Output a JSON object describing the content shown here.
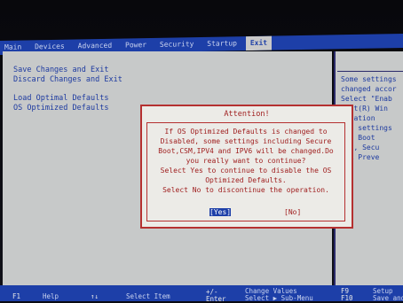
{
  "menu": {
    "tabs": [
      "Main",
      "Devices",
      "Advanced",
      "Power",
      "Security",
      "Startup",
      "Exit"
    ],
    "active_tab": "Exit"
  },
  "main": {
    "items": [
      "Save Changes and Exit",
      "Discard Changes and Exit",
      "Load Optimal Defaults",
      "OS Optimized Defaults"
    ]
  },
  "help": {
    "lines": [
      "Some settings",
      "changed accor",
      "Select \"Enab",
      "soft(R) Win",
      "fication",
      "ert settings",
      "rt, Boot",
      "ity, Secu",
      "ack Preve"
    ]
  },
  "dialog": {
    "title": "Attention!",
    "message": [
      "If OS Optimized Defaults is changed to",
      "Disabled, some settings including Secure",
      "Boot,CSM,IPV4 and IPV6 will be changed.Do",
      "you really want to continue?",
      "Select Yes to continue to disable the OS",
      "Optimized Defaults.",
      "Select No  to discontinue the operation."
    ],
    "yes_label": "[Yes]",
    "no_label": "[No]"
  },
  "footer": {
    "f1_key": "F1",
    "f1_label": "Help",
    "updown_key": "↑↓",
    "updown_label": "Select Item",
    "minusplus_key": "+/-",
    "minusplus_label": "Change Values",
    "enter_key": "Enter",
    "enter_label": "Select ▶ Sub-Menu",
    "f9_key": "F9",
    "f9_label": "Setup",
    "f10_key": "F10",
    "f10_label": "Save and"
  },
  "colors": {
    "menu_blue": "#1d3fa8",
    "panel_gray": "#c7c9c9",
    "dialog_red": "#b53030"
  }
}
